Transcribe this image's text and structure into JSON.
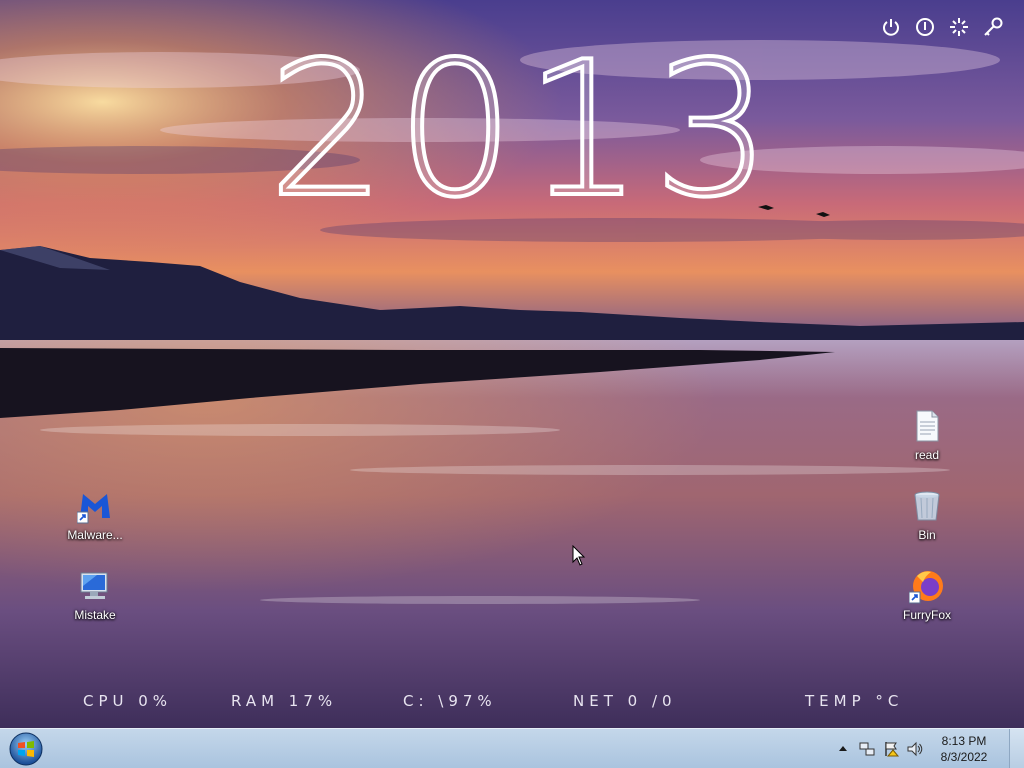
{
  "wallpaper": {
    "sky_top_color": "#5a4c9a",
    "sky_glow_color": "#f0a050",
    "water_color": "#6e4a7a",
    "mountain_color": "#1e1e3c"
  },
  "year_widget": {
    "year": "2013"
  },
  "system_icons": [
    {
      "name": "power-icon"
    },
    {
      "name": "restart-icon"
    },
    {
      "name": "sleep-icon"
    },
    {
      "name": "key-icon"
    }
  ],
  "desktop_icons": {
    "malwarebytes": {
      "label": "Malware...",
      "icon": "malwarebytes-icon"
    },
    "mistake": {
      "label": "Mistake",
      "icon": "computer-icon"
    },
    "read": {
      "label": "read",
      "icon": "text-file-icon"
    },
    "bin": {
      "label": "Bin",
      "icon": "recycle-bin-icon"
    },
    "furryfox": {
      "label": "FurryFox",
      "icon": "firefox-icon"
    }
  },
  "stats": {
    "cpu": "CPU 0%",
    "ram": "RAM 17%",
    "disk": "C: \\97%",
    "net": "NET 0 /0",
    "temp": "TEMP °C"
  },
  "taskbar": {
    "start_icon": "windows-start-icon",
    "clock_time": "8:13 PM",
    "clock_date": "8/3/2022",
    "tray_icons": [
      "chevron-up-icon",
      "network-icon",
      "action-center-flag-icon",
      "speaker-icon"
    ]
  }
}
